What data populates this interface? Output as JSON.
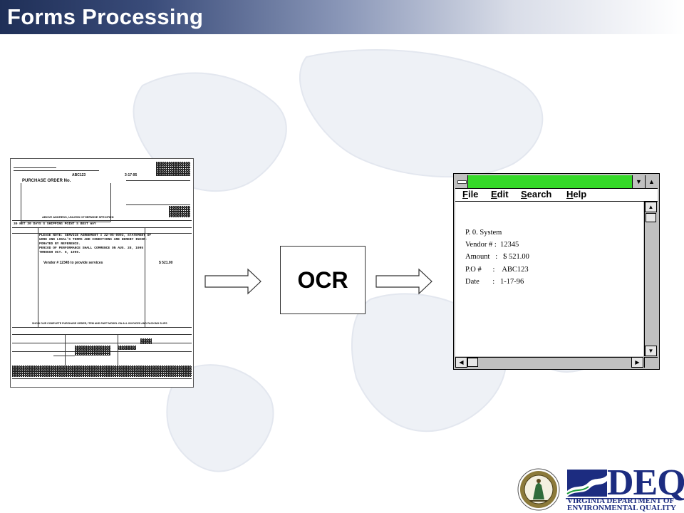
{
  "header": {
    "title": "Forms Processing"
  },
  "scanned_form": {
    "vendor_code": "ABC123",
    "date_stamp": "3-17-95",
    "title": "PURCHASE ORDER No.",
    "address_note": "ABOVE ADDRESS, UNLESS OTHERWISE SPECIFIED",
    "typed_row": "30 NET   30 DAYS      S SHIPPING POINT     S  BEST WAY",
    "body_lines": [
      "PLEASE NOTE: SERVICE AGREEMENT # 32-95-0093, STATEMENT OF",
      "WORK AND LOGAL'S TERMS AND CONDITIONS ARE HEREBY INCOR-",
      "PORATED BY REFERENCE.",
      "PERIOD OF PERFORMANCE SHALL COMMENCE ON AUG. 28, 1995",
      "THROUGH OCT. 6, 1995."
    ],
    "line_item": "Vendor # 12345 to provide services",
    "line_amount": "$ 521.00",
    "footer_note": "SHOW OUR COMPLETE PURCHASE ORDER, ITEM AND PART MODEL ON ALL INVOICES AND PACKING SLIPS"
  },
  "ocr": {
    "label": "OCR"
  },
  "window": {
    "menu": [
      {
        "label": "File",
        "accel": "F",
        "rest": "ile"
      },
      {
        "label": "Edit",
        "accel": "E",
        "rest": "dit"
      },
      {
        "label": "Search",
        "accel": "S",
        "rest": "earch"
      },
      {
        "label": "Help",
        "accel": "H",
        "rest": "elp"
      }
    ],
    "fields": [
      "P. 0. System",
      "Vendor # :  12345",
      "Amount   :   $ 521.00",
      "P.O #      :    ABC123",
      "Date       :   1-17-96"
    ]
  },
  "logos": {
    "deq_wordmark": "DEQ",
    "deq_line1": "VIRGINIA DEPARTMENT OF",
    "deq_line2": "ENVIRONMENTAL QUALITY"
  },
  "colors": {
    "title_bar_dark": "#1f2f57",
    "window_title_green": "#35d928",
    "deq_blue": "#1c2c80"
  }
}
